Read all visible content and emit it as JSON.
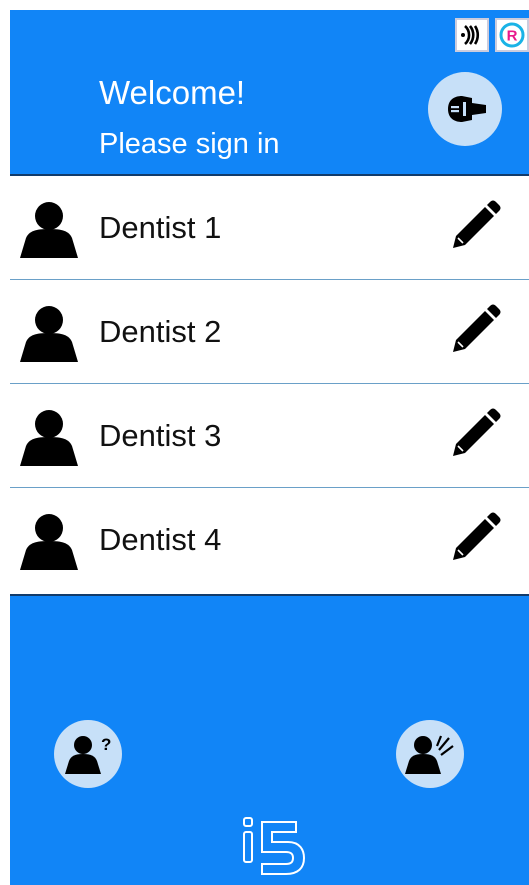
{
  "header": {
    "welcome": "Welcome!",
    "subtitle": "Please sign in",
    "status_icons": [
      {
        "icon": "nfc-icon"
      },
      {
        "icon": "registered-icon",
        "text": "R"
      }
    ],
    "settings_icon": "wrench-icon"
  },
  "dentists": [
    {
      "name": "Dentist 1"
    },
    {
      "name": "Dentist 2"
    },
    {
      "name": "Dentist 3"
    },
    {
      "name": "Dentist 4"
    }
  ],
  "footer": {
    "left_button_icon": "unknown-user-icon",
    "left_button_mark": "?",
    "right_button_icon": "voice-user-icon",
    "logo": "i5"
  },
  "colors": {
    "primary": "#1185f7",
    "button_bg": "#c7e0f8",
    "divider": "#6aa0c8",
    "registered_pink": "#e8198b",
    "registered_cyan": "#1ab3e6"
  }
}
